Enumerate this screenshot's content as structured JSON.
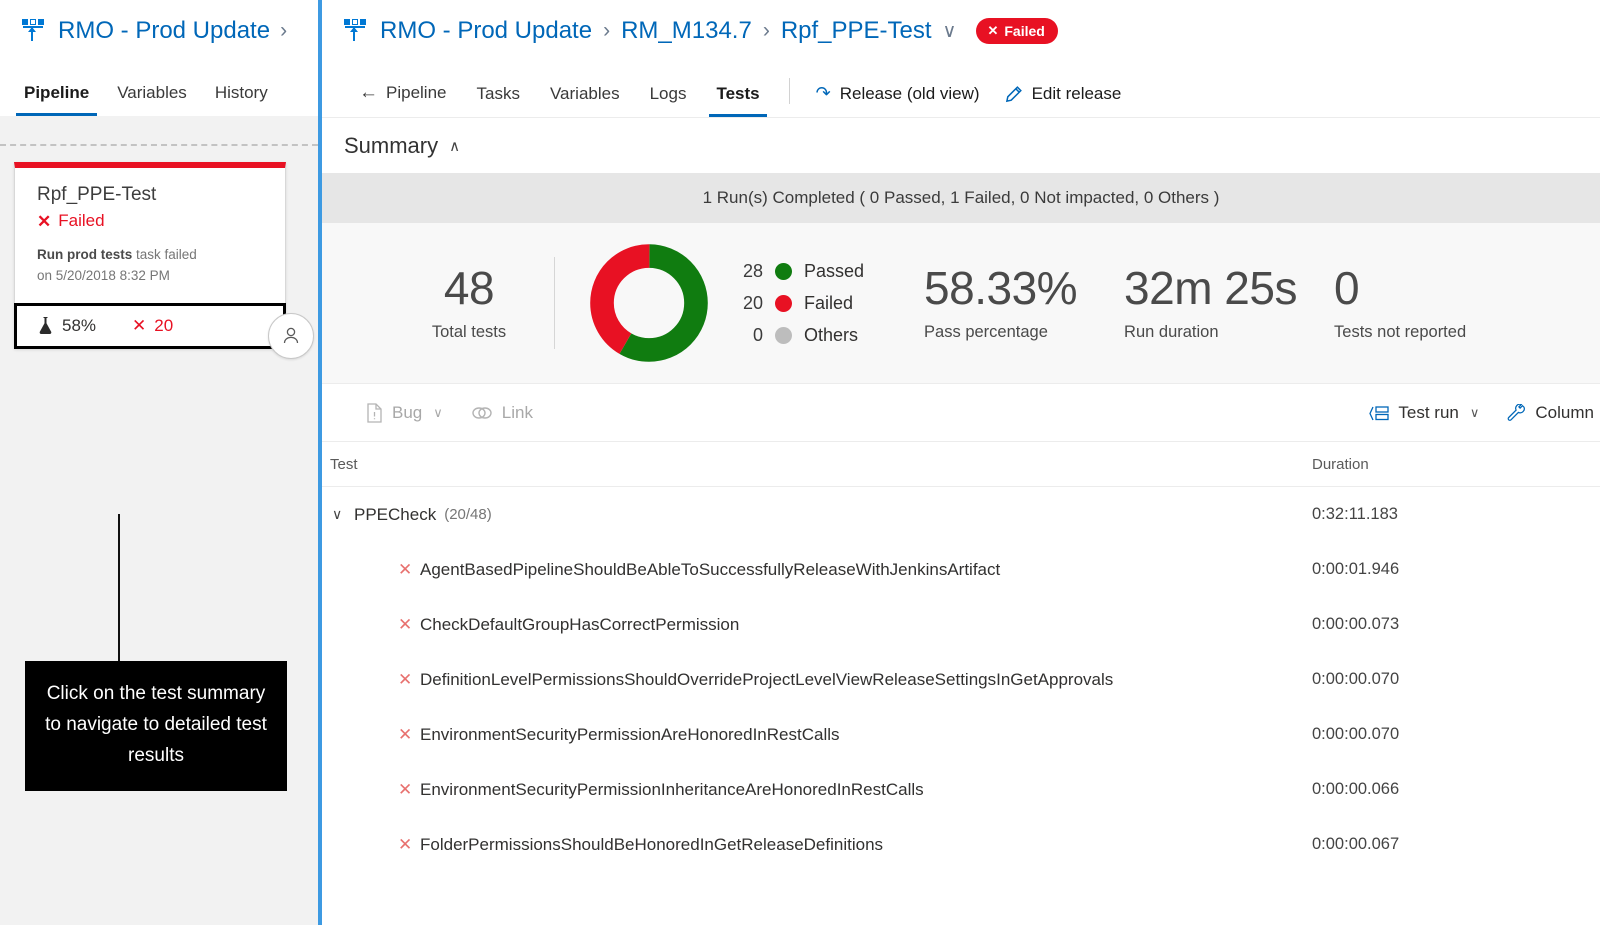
{
  "left_panel": {
    "title": "RMO - Prod Update",
    "breadcrumb_chevron": "›",
    "tabs": [
      {
        "label": "Pipeline",
        "active": true
      },
      {
        "label": "Variables",
        "active": false
      },
      {
        "label": "History",
        "active": false
      }
    ],
    "release_card": {
      "name": "Rpf_PPE-Test",
      "status_icon": "✕",
      "status": "Failed",
      "desc_bold": "Run prod tests",
      "desc_rest": " task failed",
      "desc_line2": "on 5/20/2018 8:32 PM",
      "metric_pass": "58%",
      "metric_fail_icon": "✕",
      "metric_fail": "20",
      "accent_color": "#e81123"
    },
    "callout": "Click on the test summary to navigate to detailed test results"
  },
  "main": {
    "breadcrumb": {
      "root": "RMO - Prod Update",
      "sep": "›",
      "stage": "RM_M134.7",
      "env": "Rpf_PPE-Test",
      "chevron": "∨",
      "badge_icon": "✕",
      "badge": "Failed",
      "badge_color": "#e81123"
    },
    "tabs": [
      {
        "label": "Pipeline",
        "active": false,
        "back": true
      },
      {
        "label": "Tasks",
        "active": false
      },
      {
        "label": "Variables",
        "active": false
      },
      {
        "label": "Logs",
        "active": false
      },
      {
        "label": "Tests",
        "active": true
      }
    ],
    "tools": [
      {
        "label": "Release (old view)",
        "icon": "share-icon"
      },
      {
        "label": "Edit release",
        "icon": "pencil-icon"
      }
    ],
    "summary": {
      "title": "Summary",
      "caret": "∧",
      "run_banner": "1 Run(s) Completed ( 0 Passed, 1 Failed, 0 Not impacted, 0 Others )",
      "stats": {
        "total_value": "48",
        "total_label": "Total tests",
        "pass_pct_value": "58.33%",
        "pass_pct_label": "Pass percentage",
        "duration_value": "32m 25s",
        "duration_label": "Run duration",
        "not_reported_value": "0",
        "not_reported_label": "Tests not reported"
      }
    },
    "grid_toolbar": {
      "bug_label": "Bug",
      "bug_caret": "∨",
      "link_label": "Link",
      "test_run_label": "Test run",
      "test_run_caret": "∨",
      "column_label": "Column "
    },
    "table": {
      "headers": {
        "test": "Test",
        "duration": "Duration"
      },
      "group": {
        "caret": "∨",
        "name": "PPECheck",
        "count": "(20/48)",
        "duration": "0:32:11.183"
      },
      "rows": [
        {
          "icon": "✕",
          "name": "AgentBasedPipelineShouldBeAbleToSuccessfullyReleaseWithJenkinsArtifact",
          "duration": "0:00:01.946"
        },
        {
          "icon": "✕",
          "name": "CheckDefaultGroupHasCorrectPermission",
          "duration": "0:00:00.073"
        },
        {
          "icon": "✕",
          "name": "DefinitionLevelPermissionsShouldOverrideProjectLevelViewReleaseSettingsInGetApprovals",
          "duration": "0:00:00.070"
        },
        {
          "icon": "✕",
          "name": "EnvironmentSecurityPermissionAreHonoredInRestCalls",
          "duration": "0:00:00.070"
        },
        {
          "icon": "✕",
          "name": "EnvironmentSecurityPermissionInheritanceAreHonoredInRestCalls",
          "duration": "0:00:00.066"
        },
        {
          "icon": "✕",
          "name": "FolderPermissionsShouldBeHonoredInGetReleaseDefinitions",
          "duration": "0:00:00.067"
        }
      ]
    }
  },
  "chart_data": {
    "type": "pie",
    "title": "Test outcome distribution",
    "categories": [
      "Passed",
      "Failed",
      "Others"
    ],
    "values": [
      28,
      20,
      0
    ],
    "colors": [
      "#107c10",
      "#e81123",
      "#bdbdbd"
    ],
    "total": 48,
    "legend_position": "right",
    "legend": [
      {
        "count": "28",
        "label": "Passed",
        "color": "#107c10"
      },
      {
        "count": "20",
        "label": "Failed",
        "color": "#e81123"
      },
      {
        "count": "0",
        "label": "Others",
        "color": "#bdbdbd"
      }
    ]
  }
}
